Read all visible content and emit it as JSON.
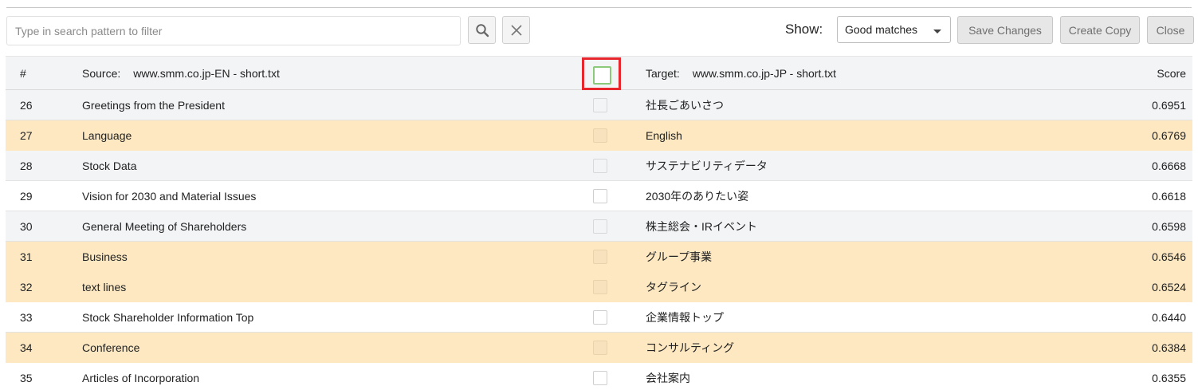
{
  "toolbar": {
    "search_placeholder": "Type in search pattern to filter",
    "search_value": "",
    "search_icon": "search-icon",
    "clear_icon": "close-icon",
    "show_label": "Show:",
    "show_selected": "Good matches",
    "save_label": "Save Changes",
    "copy_label": "Create Copy",
    "close_label": "Close"
  },
  "header": {
    "num": "#",
    "source_label": "Source:",
    "source_file": "www.smm.co.jp-EN - short.txt",
    "target_label": "Target:",
    "target_file": "www.smm.co.jp-JP - short.txt",
    "score": "Score"
  },
  "colors": {
    "highlight_row": "#fde8c1",
    "zebra_row": "#f3f4f6",
    "focus_frame": "#e8262d",
    "checkbox_focus": "#8bc97b"
  },
  "rows": [
    {
      "num": "26",
      "source": "Greetings from the President",
      "target": "社長ごあいさつ",
      "score": "0.6951",
      "style": "zebra"
    },
    {
      "num": "27",
      "source": "Language",
      "target": "English",
      "score": "0.6769",
      "style": "hl"
    },
    {
      "num": "28",
      "source": "Stock Data",
      "target": "サステナビリティデータ",
      "score": "0.6668",
      "style": "zebra"
    },
    {
      "num": "29",
      "source": "Vision for 2030 and Material Issues",
      "target": "2030年のありたい姿",
      "score": "0.6618",
      "style": "white"
    },
    {
      "num": "30",
      "source": "General Meeting of Shareholders",
      "target": "株主総会・IRイベント",
      "score": "0.6598",
      "style": "zebra"
    },
    {
      "num": "31",
      "source": "Business",
      "target": "グループ事業",
      "score": "0.6546",
      "style": "hl"
    },
    {
      "num": "32",
      "source": "text lines",
      "target": "タグライン",
      "score": "0.6524",
      "style": "hl"
    },
    {
      "num": "33",
      "source": "Stock Shareholder Information Top",
      "target": "企業情報トップ",
      "score": "0.6440",
      "style": "white"
    },
    {
      "num": "34",
      "source": "Conference",
      "target": "コンサルティング",
      "score": "0.6384",
      "style": "hl"
    },
    {
      "num": "35",
      "source": "Articles of Incorporation",
      "target": "会社案内",
      "score": "0.6355",
      "style": "white"
    }
  ]
}
